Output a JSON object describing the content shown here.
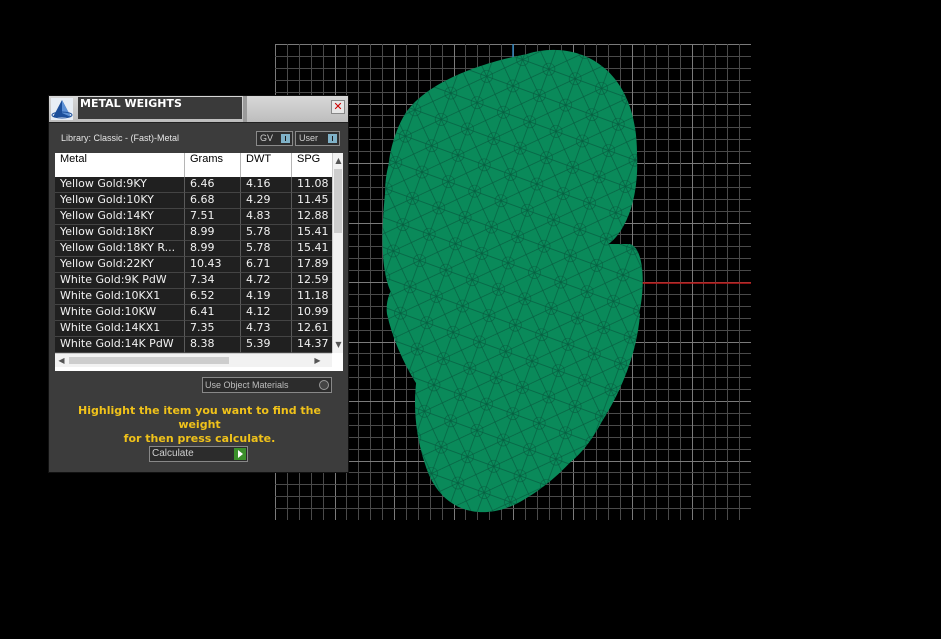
{
  "panel": {
    "title": "METAL WEIGHTS",
    "close_glyph": "✕",
    "library_label": "Library: Classic - (Fast)-Metal",
    "gv_label": "GV",
    "user_label": "User",
    "columns": [
      "Metal",
      "Grams",
      "DWT",
      "SPG"
    ],
    "rows": [
      [
        "Yellow Gold:9KY",
        "6.46",
        "4.16",
        "11.08"
      ],
      [
        "Yellow Gold:10KY",
        "6.68",
        "4.29",
        "11.45"
      ],
      [
        "Yellow Gold:14KY",
        "7.51",
        "4.83",
        "12.88"
      ],
      [
        "Yellow Gold:18KY",
        "8.99",
        "5.78",
        "15.41"
      ],
      [
        "Yellow Gold:18KY R...",
        "8.99",
        "5.78",
        "15.41"
      ],
      [
        "Yellow Gold:22KY",
        "10.43",
        "6.71",
        "17.89"
      ],
      [
        "White Gold:9K PdW",
        "7.34",
        "4.72",
        "12.59"
      ],
      [
        "White Gold:10KX1",
        "6.52",
        "4.19",
        "11.18"
      ],
      [
        "White Gold:10KW",
        "6.41",
        "4.12",
        "10.99"
      ],
      [
        "White Gold:14KX1",
        "7.35",
        "4.73",
        "12.61"
      ],
      [
        "White Gold:14K PdW",
        "8.38",
        "5.39",
        "14.37"
      ]
    ],
    "use_object_materials": "Use Object Materials",
    "help_line1": "Highlight the item you want to find the weight",
    "help_line2": "for then press calculate.",
    "calculate_label": "Calculate"
  },
  "icons": {
    "logo": "pyramid-logo-icon",
    "close": "close-icon",
    "calculate": "play-arrow-icon"
  },
  "colors": {
    "model_fill": "#0a8a5a",
    "grid_line": "#5a5a5a",
    "axis_x": "#c01818",
    "axis_y": "#2a7fb8",
    "help_text": "#f0c21a"
  }
}
